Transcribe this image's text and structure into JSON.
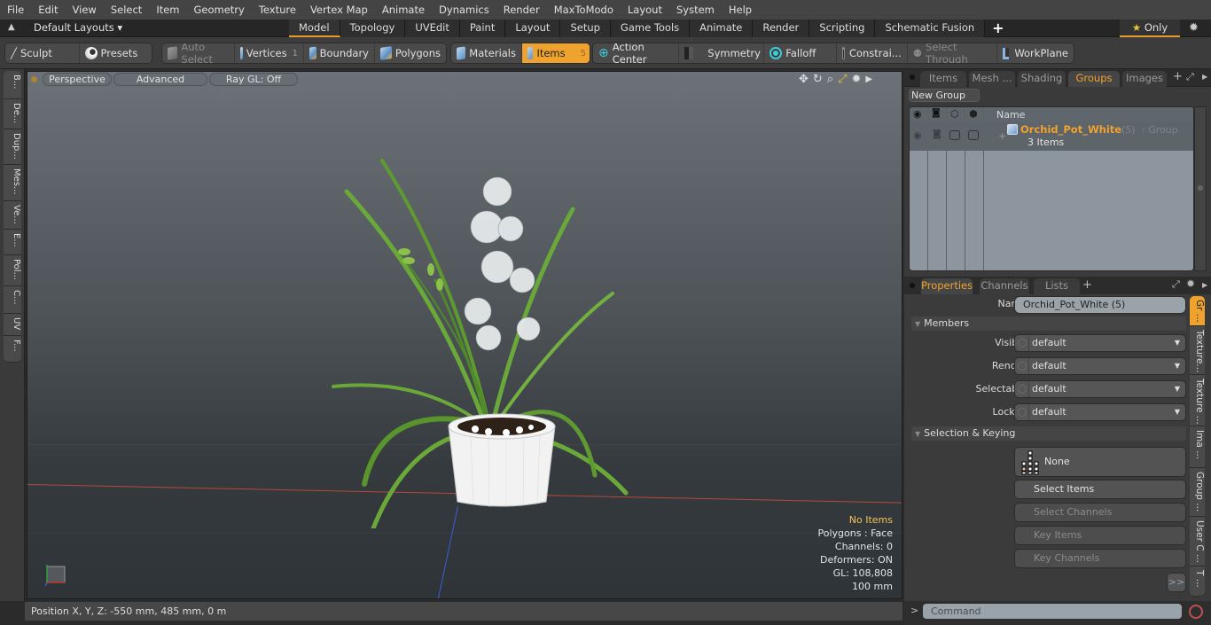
{
  "menubar": [
    "File",
    "Edit",
    "View",
    "Select",
    "Item",
    "Geometry",
    "Texture",
    "Vertex Map",
    "Animate",
    "Dynamics",
    "Render",
    "MaxToModo",
    "Layout",
    "System",
    "Help"
  ],
  "layoutbar": {
    "layout_dropdown": "Default Layouts ▾",
    "tabs": [
      "Model",
      "Topology",
      "UVEdit",
      "Paint",
      "Layout",
      "Setup",
      "Game Tools",
      "Animate",
      "Render",
      "Scripting",
      "Schematic Fusion"
    ],
    "active_tab": "Model",
    "add_tab": "+",
    "only_label": "Only"
  },
  "toolbar": {
    "sculpt": "Sculpt",
    "presets": "Presets",
    "auto_select": "Auto Select",
    "vertices": "Vertices",
    "vertices_count": "1",
    "boundary": "Boundary",
    "polygons": "Polygons",
    "materials": "Materials",
    "items": "Items",
    "items_count": "5",
    "action_center": "Action Center",
    "symmetry": "Symmetry",
    "falloff": "Falloff",
    "constraints": "Constrai...",
    "select_through": "Select Through",
    "workplane": "WorkPlane"
  },
  "left_tabs": [
    "B...",
    "De...",
    "Dup...",
    "Mes...",
    "Ve...",
    "E...",
    "Pol...",
    "C...",
    "UV",
    "F..."
  ],
  "viewport": {
    "view_mode": "Perspective",
    "shading": "Advanced",
    "raygl": "Ray GL: Off",
    "info": {
      "selection": "No Items",
      "polygons": "Polygons : Face",
      "channels": "Channels: 0",
      "deformers": "Deformers: ON",
      "gl": "GL: 108,808",
      "scale": "100 mm"
    }
  },
  "statusbar": {
    "position": "Position X, Y, Z:   -550 mm, 485 mm, 0 m"
  },
  "right_panel": {
    "top_tabs": [
      "Items",
      "Mesh ...",
      "Shading",
      "Groups",
      "Images"
    ],
    "active_top_tab": "Groups",
    "new_group": "New Group",
    "list_header": {
      "name": "Name"
    },
    "groups": [
      {
        "name": "Orchid_Pot_White",
        "count": "(5)",
        "type": ": Group",
        "sub": "3 Items"
      }
    ],
    "prop_tabs": [
      "Properties",
      "Channels",
      "Lists"
    ],
    "active_prop_tab": "Properties",
    "properties": {
      "name_label": "Name",
      "name_value": "Orchid_Pot_White (5)",
      "members_section": "Members",
      "fields": [
        {
          "label": "Visible",
          "value": "default"
        },
        {
          "label": "Render",
          "value": "default"
        },
        {
          "label": "Selectable",
          "value": "default"
        },
        {
          "label": "Locked",
          "value": "default"
        }
      ],
      "selection_section": "Selection & Keying",
      "none_label": "None",
      "select_items": "Select Items",
      "select_channels": "Select Channels",
      "key_items": "Key Items",
      "key_channels": "Key Channels",
      "more": ">>"
    },
    "side_tabs": [
      "Gr ...",
      "Texture...",
      "Texture ...",
      "Ima ...",
      "Group ...",
      "User C ...",
      "T ..."
    ],
    "command_prompt": ">",
    "command_placeholder": "Command"
  },
  "colors": {
    "accent": "#f0a22f",
    "info_highlight": "#f2c55a"
  }
}
